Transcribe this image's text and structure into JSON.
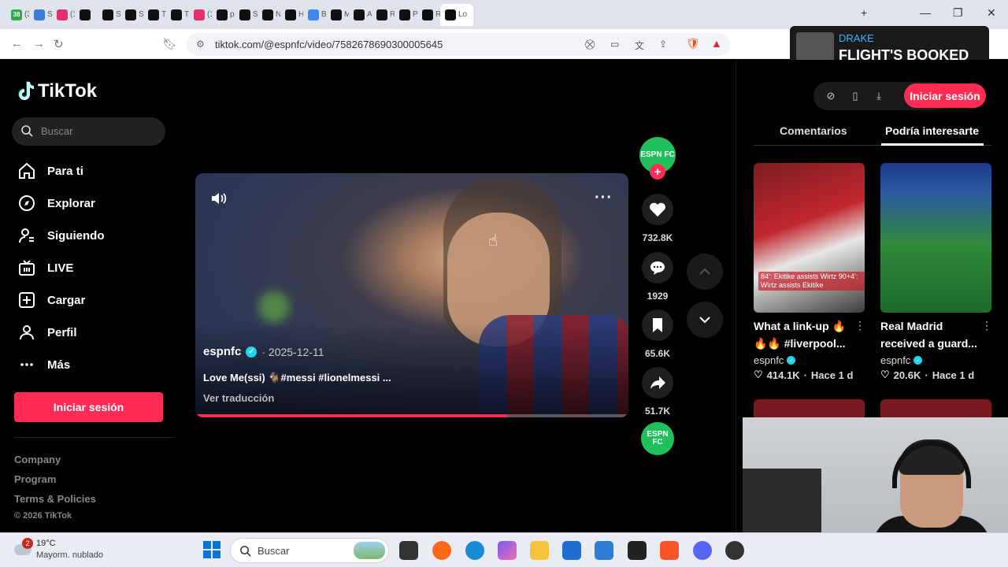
{
  "browser": {
    "tabs": [
      {
        "label": "(3",
        "color": "#2fa84f",
        "badge": "38"
      },
      {
        "label": "Sc",
        "color": "#3b7bdc"
      },
      {
        "label": "(1",
        "color": "#e1306c"
      },
      {
        "label": "",
        "color": "#111"
      },
      {
        "label": "Sc",
        "color": "#111"
      },
      {
        "label": "Sc",
        "color": "#111"
      },
      {
        "label": "Ti",
        "color": "#111"
      },
      {
        "label": "Tu",
        "color": "#111"
      },
      {
        "label": "(1",
        "color": "#e1306c"
      },
      {
        "label": "pc",
        "color": "#111"
      },
      {
        "label": "Sl",
        "color": "#111"
      },
      {
        "label": "N",
        "color": "#111"
      },
      {
        "label": "H",
        "color": "#111"
      },
      {
        "label": "B",
        "color": "#4285f4"
      },
      {
        "label": "M",
        "color": "#111"
      },
      {
        "label": "A",
        "color": "#111"
      },
      {
        "label": "R",
        "color": "#111"
      },
      {
        "label": "P",
        "color": "#111"
      },
      {
        "label": "R",
        "color": "#111"
      },
      {
        "label": "Lo",
        "color": "#111",
        "active": true
      }
    ],
    "url": "tiktok.com/@espnfc/video/7582678690300005645"
  },
  "media_overlay": {
    "artist": "DRAKE",
    "title": "FLIGHT'S BOOKED"
  },
  "sidebar": {
    "logo": "TikTok",
    "search_placeholder": "Buscar",
    "nav": [
      {
        "label": "Para ti",
        "icon": "home-icon"
      },
      {
        "label": "Explorar",
        "icon": "compass-icon"
      },
      {
        "label": "Siguiendo",
        "icon": "following-icon"
      },
      {
        "label": "LIVE",
        "icon": "live-icon"
      },
      {
        "label": "Cargar",
        "icon": "upload-icon"
      },
      {
        "label": "Perfil",
        "icon": "profile-icon"
      },
      {
        "label": "Más",
        "icon": "more-icon"
      }
    ],
    "login": "Iniciar sesión",
    "footer": [
      "Company",
      "Program",
      "Terms & Policies"
    ],
    "copyright": "© 2026 TikTok"
  },
  "video": {
    "author": "espnfc",
    "date": "· 2025-12-11",
    "caption": "Love Me(ssi) 🐐#messi #lionelmessi ...",
    "translate": "Ver traducción",
    "progress_pct": 72
  },
  "actions": {
    "avatar_text": "ESPN FC",
    "likes": "732.8K",
    "comments": "1929",
    "saves": "65.6K",
    "shares": "51.7K"
  },
  "right_panel": {
    "login": "Iniciar sesión",
    "tab_comments": "Comentarios",
    "tab_suggested": "Podría interesarte",
    "cards": [
      {
        "title": "What a link-up 🔥🔥🔥 #liverpool...",
        "author": "espnfc",
        "likes": "414.1K",
        "time": "Hace 1 d",
        "thumb_caption": "84': Ekitike assists Wirtz 90+4': Wirtz assists Ekitike"
      },
      {
        "title": "Real Madrid received a guard...",
        "author": "espnfc",
        "likes": "20.6K",
        "time": "Hace 1 d"
      }
    ]
  },
  "taskbar": {
    "temp": "19°C",
    "weather": "Mayorm. nublado",
    "badge": "2",
    "search": "Buscar"
  }
}
